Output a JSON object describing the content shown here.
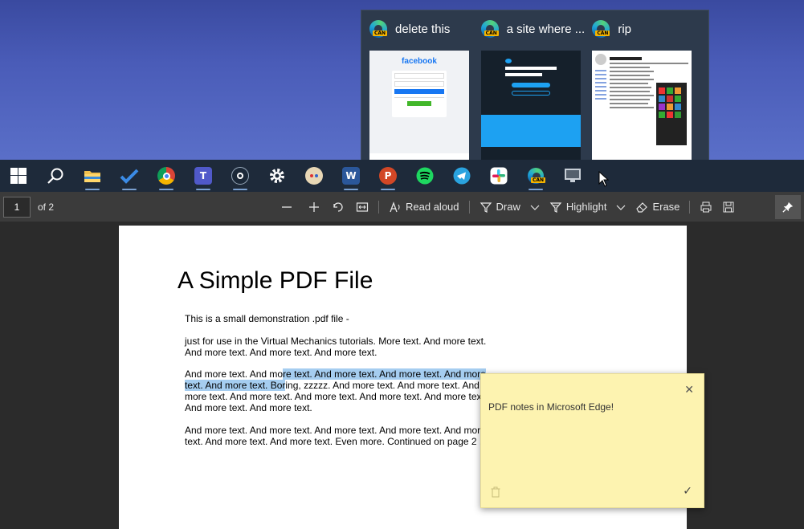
{
  "thumbnails": [
    {
      "title": "delete this",
      "badge": "CAN",
      "kind": "facebook",
      "brand": "facebook"
    },
    {
      "title": "a site where ...",
      "badge": "CAN",
      "kind": "twitter"
    },
    {
      "title": "rip",
      "badge": "CAN",
      "kind": "wikipedia"
    }
  ],
  "taskbar": {
    "items": [
      "windows-start",
      "search",
      "file-explorer",
      "todo",
      "chrome",
      "teams",
      "steam",
      "settings",
      "paint",
      "word",
      "powerpoint",
      "spotify",
      "telegram",
      "slack",
      "edge-canary",
      "snipping-tool"
    ],
    "word_letter": "W",
    "ppt_letter": "P"
  },
  "toolbar": {
    "page_value": "1",
    "of_total": "of 2",
    "read_aloud": "Read aloud",
    "draw": "Draw",
    "highlight": "Highlight",
    "erase": "Erase"
  },
  "pdf": {
    "title": "A Simple PDF File",
    "p1": "This is a small demonstration .pdf file -",
    "p2": "just for use in the Virtual Mechanics tutorials. More text. And more text. And more text. And more text. And more text.",
    "p3a": "And more text. And mo",
    "p3b": "re text. And more text. And more text. And more text. And more text. Bor",
    "p3c": "ing, zzzzz. And more text. And more text. And more text. And more text. And more text. And more text. And more text. And more text. And more text.",
    "p4": "And more text. And more text. And more text. And more text. And more text. And more text. And more text. Even more. Continued on page 2 ..."
  },
  "note": {
    "text": "PDF notes in Microsoft Edge!"
  },
  "colors": {
    "note_bg": "#fdf3b0",
    "highlight": "#a5cdf0",
    "toolbar_bg": "#3b3b3b"
  }
}
